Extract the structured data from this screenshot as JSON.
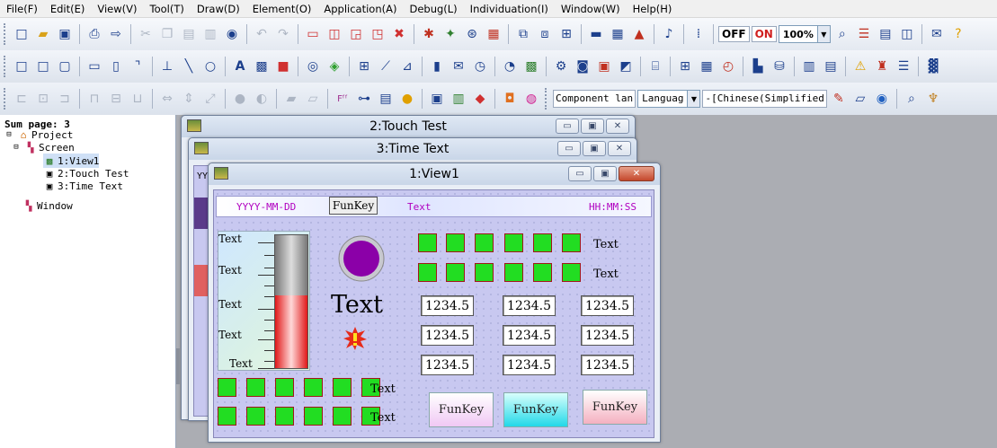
{
  "menu": [
    "File(F)",
    "Edit(E)",
    "View(V)",
    "Tool(T)",
    "Draw(D)",
    "Element(O)",
    "Application(A)",
    "Debug(L)",
    "Individuation(I)",
    "Window(W)",
    "Help(H)"
  ],
  "toolbar": {
    "off_label": "OFF",
    "on_label": "ON",
    "zoom_value": "100%",
    "component_label": "Component lan",
    "language_label": "Languag",
    "chinese_label": "-[Chinese(Simplified"
  },
  "tree": {
    "sum_page": "Sum page: 3",
    "project": "Project",
    "screen": "Screen",
    "items": [
      "1:View1",
      "2:Touch Test",
      "3:Time Text"
    ],
    "window": "Window"
  },
  "windows": {
    "touch_title": "2:Touch Test",
    "time_title": "3:Time Text",
    "view_title": "1:View1",
    "peek_text": "YY"
  },
  "view": {
    "date_text": "YYYY-MM-DD",
    "header_funkey": "FunKey",
    "header_text": "Text",
    "time_text": "HH:MM:SS",
    "gauge_labels": [
      "Text",
      "Text",
      "Text",
      "Text",
      "Text"
    ],
    "gauge_level": 0.55,
    "big_text": "Text",
    "led_row_labels": [
      "Text",
      "Text"
    ],
    "bottom_led_labels": [
      "Text",
      "Text"
    ],
    "numbers": [
      [
        "1234.5",
        "1234.5",
        "1234.5"
      ],
      [
        "1234.5",
        "1234.5",
        "1234.5"
      ],
      [
        "1234.5",
        "1234.5",
        "1234.5"
      ]
    ],
    "funkeys": [
      "FunKey",
      "FunKey",
      "FunKey"
    ]
  },
  "colors": {
    "accent_text": "#b000c0",
    "led_fill": "#22dd22",
    "led_border": "#a01818",
    "canvas_bg": "#c8c8f0",
    "knob": "#8b00a8"
  }
}
